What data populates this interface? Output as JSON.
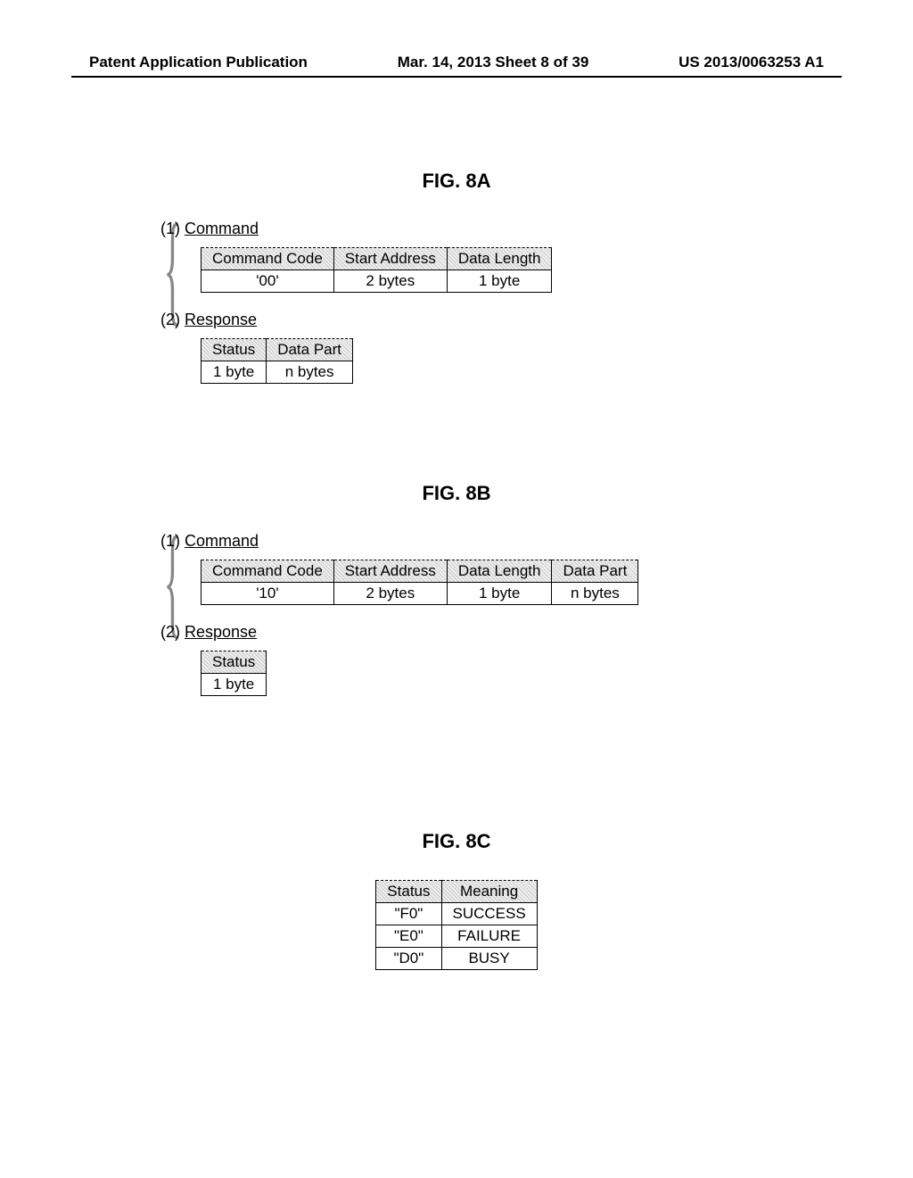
{
  "header": {
    "left": "Patent Application Publication",
    "center": "Mar. 14, 2013  Sheet 8 of 39",
    "right": "US 2013/0063253 A1"
  },
  "fig_a": {
    "title": "FIG. 8A",
    "command_label": "(1) ",
    "command_underline": "Command",
    "command_headers": [
      "Command Code",
      "Start Address",
      "Data Length"
    ],
    "command_values": [
      "'00'",
      "2 bytes",
      "1 byte"
    ],
    "response_label": "(2) ",
    "response_underline": "Response",
    "response_headers": [
      "Status",
      "Data Part"
    ],
    "response_values": [
      "1 byte",
      "n bytes"
    ]
  },
  "fig_b": {
    "title": "FIG. 8B",
    "command_label": "(1) ",
    "command_underline": "Command",
    "command_headers": [
      "Command Code",
      "Start Address",
      "Data Length",
      "Data Part"
    ],
    "command_values": [
      "'10'",
      "2 bytes",
      "1 byte",
      "n bytes"
    ],
    "response_label": "(2) ",
    "response_underline": "Response",
    "response_headers": [
      "Status"
    ],
    "response_values": [
      "1 byte"
    ]
  },
  "fig_c": {
    "title": "FIG. 8C",
    "headers": [
      "Status",
      "Meaning"
    ],
    "rows": [
      [
        "\"F0\"",
        "SUCCESS"
      ],
      [
        "\"E0\"",
        "FAILURE"
      ],
      [
        "\"D0\"",
        "BUSY"
      ]
    ]
  }
}
